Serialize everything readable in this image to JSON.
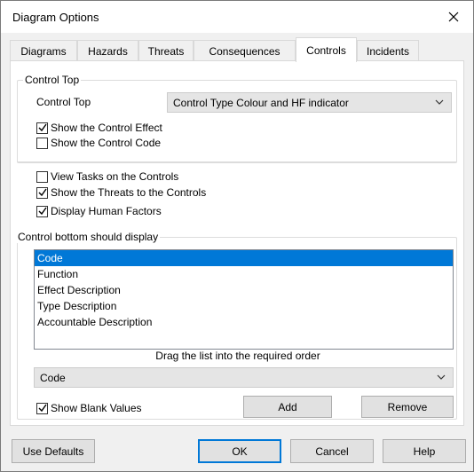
{
  "window": {
    "title": "Diagram Options"
  },
  "tabs": [
    {
      "label": "Diagrams"
    },
    {
      "label": "Hazards"
    },
    {
      "label": "Threats"
    },
    {
      "label": "Consequences"
    },
    {
      "label": "Controls",
      "active": true
    },
    {
      "label": "Incidents"
    }
  ],
  "control_top": {
    "group_label": "Control Top",
    "field_label": "Control Top",
    "selected": "Control Type Colour and HF indicator",
    "show_effect": {
      "label": "Show the Control Effect",
      "checked": true
    },
    "show_code": {
      "label": "Show the Control Code",
      "checked": false
    }
  },
  "options": {
    "view_tasks": {
      "label": "View Tasks on the Controls",
      "checked": false
    },
    "show_threats": {
      "label": "Show the Threats to the Controls",
      "checked": true
    },
    "display_hf": {
      "label": "Display Human Factors",
      "checked": true
    }
  },
  "control_bottom": {
    "group_label": "Control bottom should display",
    "items": [
      {
        "label": "Code",
        "selected": true
      },
      {
        "label": "Function"
      },
      {
        "label": "Effect Description"
      },
      {
        "label": "Type Description"
      },
      {
        "label": "Accountable Description"
      }
    ],
    "hint": "Drag the list into the required order",
    "combo_value": "Code",
    "show_blank": {
      "label": "Show Blank Values",
      "checked": true
    },
    "add_label": "Add",
    "remove_label": "Remove"
  },
  "footer": {
    "use_defaults": "Use Defaults",
    "ok": "OK",
    "cancel": "Cancel",
    "help": "Help"
  }
}
